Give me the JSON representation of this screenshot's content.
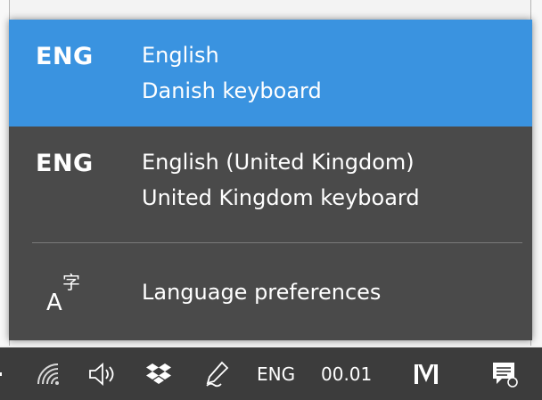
{
  "flyout": {
    "items": [
      {
        "code": "ENG",
        "language": "English",
        "keyboard": "Danish keyboard",
        "selected": true
      },
      {
        "code": "ENG",
        "language": "English (United Kingdom)",
        "keyboard": "United Kingdom keyboard",
        "selected": false
      }
    ],
    "preferences_label": "Language preferences",
    "preferences_icon": "language-preferences-icon"
  },
  "taskbar": {
    "icons": [
      "network-icon",
      "volume-icon",
      "dropbox-icon",
      "pen-icon",
      "app-m-icon",
      "action-center-icon"
    ],
    "input_indicator": "ENG",
    "clock": "00.01"
  },
  "colors": {
    "flyout_bg": "#4a4a4a",
    "selected_bg": "#3a93e0",
    "taskbar_bg": "#3c3c3c",
    "text": "#ffffff"
  }
}
